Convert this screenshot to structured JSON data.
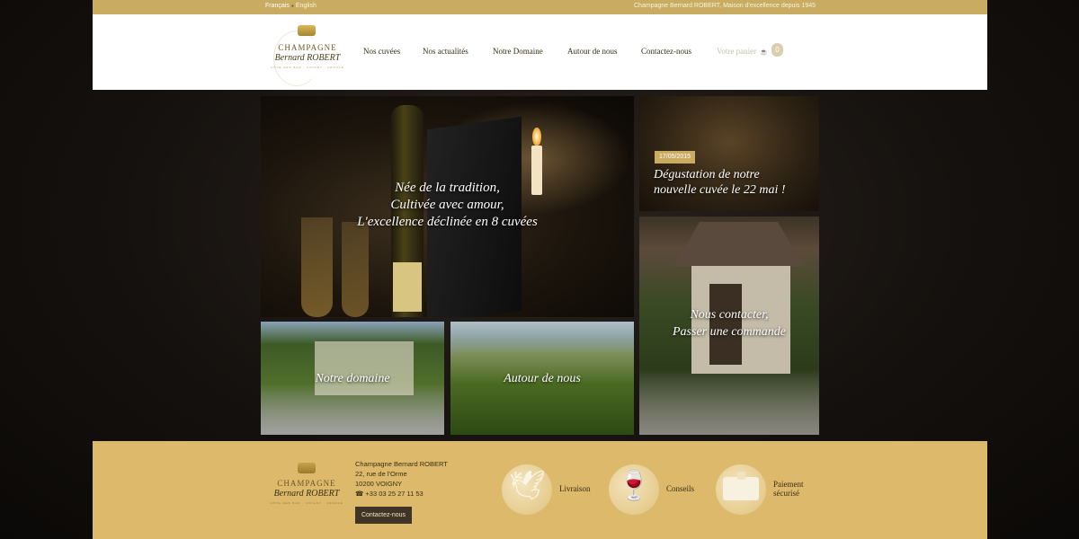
{
  "topbar": {
    "lang_fr": "Français",
    "lang_en": "English",
    "tagline": "Champagne Bernard ROBERT, Maison d'excellence depuis 1945"
  },
  "logo": {
    "line1": "CHAMPAGNE",
    "line2": "Bernard ROBERT",
    "line3": "CÔTE DES BAR · VOIGNY · FRANCE"
  },
  "nav": {
    "items": [
      {
        "label": "Nos cuvées"
      },
      {
        "label": "Nos actualités"
      },
      {
        "label": "Notre Domaine"
      },
      {
        "label": "Autour de nous"
      },
      {
        "label": "Contactez-nous"
      }
    ],
    "cart_label": "Votre panier",
    "cart_count": "0",
    "cart_icon": "basket-icon"
  },
  "tiles": {
    "hero": {
      "caption": "Née de la tradition, Cultivée avec amour, L'excellence déclinée en 8 cuvées"
    },
    "news": {
      "date": "17/05/2015",
      "caption": "Dégustation de notre nouvelle cuvée le 22 mai !"
    },
    "contact": {
      "caption": "Nous contacter, Passer une commande"
    },
    "domaine": {
      "caption": "Notre domaine"
    },
    "autour": {
      "caption": "Autour de nous"
    }
  },
  "footer": {
    "address": {
      "name": "Champagne Bernard ROBERT",
      "street": "22, rue de l'Orme",
      "city": "10200 VOIGNY",
      "phone": "☎ +33 03 25 27 11 53"
    },
    "contact_button": "Contactez-nous",
    "features": [
      {
        "label": "Livraison",
        "icon": "eagle-icon"
      },
      {
        "label": "Conseils",
        "icon": "wine-glasses-icon"
      },
      {
        "label": "Paiement sécurisé",
        "icon": "secure-card-icon"
      }
    ]
  },
  "colors": {
    "gold": "#c9ab62",
    "footer_gold": "#dcb96b",
    "dark": "#15110e"
  }
}
